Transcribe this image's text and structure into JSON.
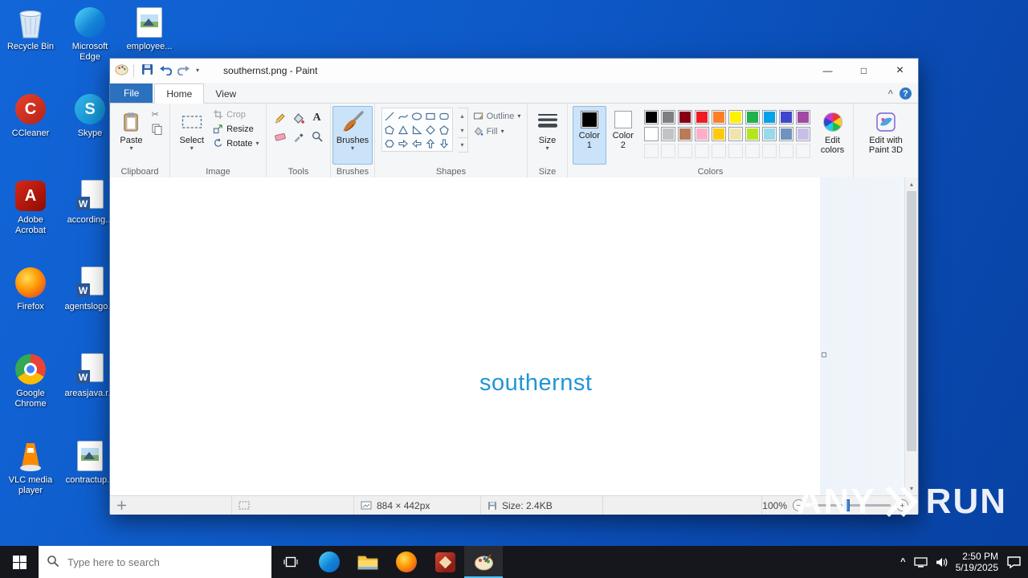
{
  "icons": {
    "caret_down": "▾",
    "caret_up": "▴",
    "scroll_more": "▾",
    "chevron_up": "^",
    "cut_glyph": "✂",
    "text_tool_glyph": "A",
    "help_glyph": "?",
    "minimize_glyph": "—",
    "maximize_glyph": "□",
    "close_glyph": "×",
    "minus_glyph": "−",
    "plus_glyph": "+",
    "skype_letter": "S",
    "ccleaner_letter": "C",
    "acrobat_letter": "A",
    "word_letter": "W"
  },
  "theme": {
    "canvas_text_color": "#1f96d6",
    "file_tab_blue": "#2b71be",
    "taskbar_bg": "#15171c"
  },
  "desktop": {
    "icons": [
      {
        "label": "Recycle Bin"
      },
      {
        "label": "Microsoft Edge"
      },
      {
        "label": "employee..."
      },
      {
        "label": "CCleaner"
      },
      {
        "label": "Skype"
      },
      {
        "label": "Adobe Acrobat"
      },
      {
        "label": "according..."
      },
      {
        "label": "Firefox"
      },
      {
        "label": "agentslogo..."
      },
      {
        "label": "Google Chrome"
      },
      {
        "label": "areasjava.r..."
      },
      {
        "label": "VLC media player"
      },
      {
        "label": "contractup..."
      }
    ]
  },
  "paint": {
    "title": "southernst.png - Paint",
    "tabs": {
      "file": "File",
      "home": "Home",
      "view": "View"
    },
    "ribbon": {
      "clipboard": {
        "group_label": "Clipboard",
        "paste_label": "Paste"
      },
      "image": {
        "group_label": "Image",
        "select_label": "Select",
        "crop_label": "Crop",
        "resize_label": "Resize",
        "rotate_label": "Rotate"
      },
      "tools": {
        "group_label": "Tools"
      },
      "brushes_label": "Brushes",
      "shapes": {
        "group_label": "Shapes",
        "outline_label": "Outline",
        "fill_label": "Fill"
      },
      "size_label": "Size",
      "colors": {
        "group_label": "Colors",
        "color1_top": "Color",
        "color1_num": "1",
        "color2_top": "Color",
        "color2_num": "2",
        "edit_top": "Edit",
        "edit_bottom": "colors",
        "row1": [
          "#000000",
          "#7f7f7f",
          "#880015",
          "#ed1c24",
          "#ff7f27",
          "#fff200",
          "#22b14c",
          "#00a2e8",
          "#3f48cc",
          "#a349a4"
        ],
        "row2": [
          "#ffffff",
          "#c3c3c3",
          "#b97a57",
          "#ffaec9",
          "#ffc90e",
          "#efe4b0",
          "#b5e61d",
          "#99d9ea",
          "#7092be",
          "#c8bfe7"
        ]
      },
      "paint3d": {
        "line1": "Edit with",
        "line2": "Paint 3D"
      }
    },
    "canvas": {
      "text": "southernst"
    },
    "status": {
      "dimensions": "884 × 442px",
      "file_size": "Size: 2.4KB",
      "zoom": "100%"
    }
  },
  "taskbar": {
    "search_placeholder": "Type here to search",
    "clock": {
      "time": "2:50 PM",
      "date": "5/19/2025"
    }
  },
  "watermark": {
    "left": "ANY",
    "right": "RUN"
  }
}
